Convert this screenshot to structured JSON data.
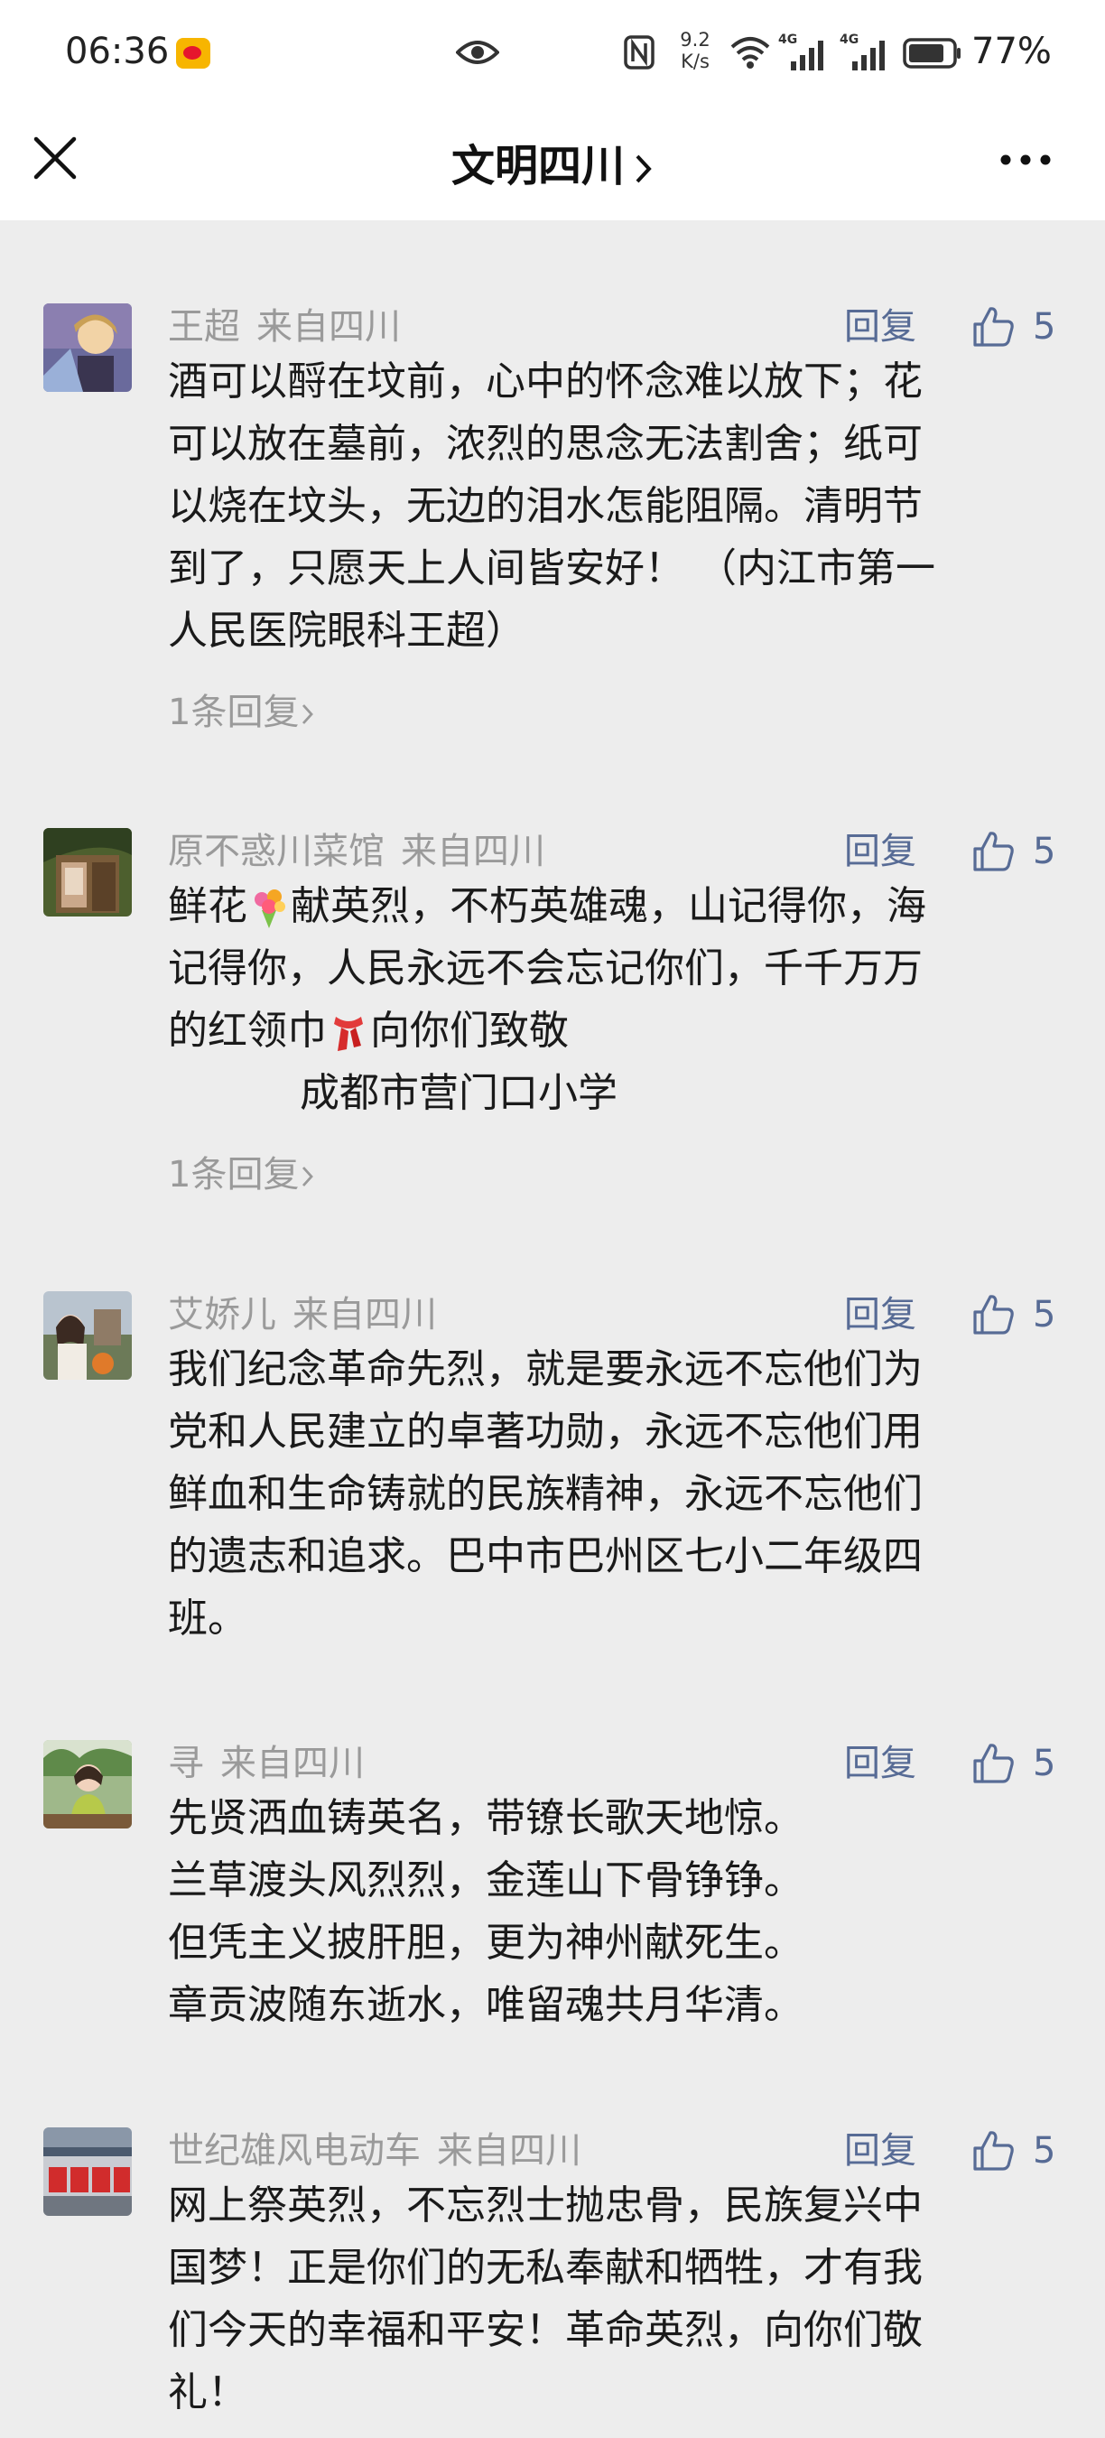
{
  "status_bar": {
    "time": "06:36",
    "net_speed_top": "9.2",
    "net_speed_bottom": "K/s",
    "signal1_label": "4G",
    "signal2_label": "4G",
    "battery": "77%"
  },
  "nav": {
    "title": "文明四川",
    "close_icon": "close-icon",
    "more_icon": "more-icon"
  },
  "labels": {
    "reply": "回复",
    "replies_link": "1条回复"
  },
  "colors": {
    "link": "#576b95",
    "meta": "#9a9a9a",
    "background": "#ededed"
  },
  "comments": [
    {
      "name": "王超",
      "location": "来自四川",
      "likes": "5",
      "lines": [
        "酒可以酹在坟前，心中的怀念难以放下；花",
        "可以放在墓前，浓烈的思念无法割舍；纸可",
        "以烧在坟头，无边的泪水怎能阻隔。清明节",
        "到了，只愿天上人间皆安好！ （内江市第一",
        "人民医院眼科王超）"
      ],
      "replies": "1条回复"
    },
    {
      "name": "原不惑川菜馆",
      "location": "来自四川",
      "likes": "5",
      "line1_a": "鲜花",
      "line1_b": "献英烈，不朽英雄魂，山记得你，海",
      "line2": "记得你，人民永远不会忘记你们，千千万万",
      "line3_a": "的红领巾",
      "line3_b": "向你们致敬",
      "line4": "成都市营门口小学",
      "replies": "1条回复"
    },
    {
      "name": "艾娇儿",
      "location": "来自四川",
      "likes": "5",
      "lines": [
        "我们纪念革命先烈，就是要永远不忘他们为",
        "党和人民建立的卓著功勋，永远不忘他们用",
        "鲜血和生命铸就的民族精神，永远不忘他们",
        "的遗志和追求。巴中市巴州区七小二年级四",
        "班。"
      ]
    },
    {
      "name": "寻",
      "location": "来自四川",
      "likes": "5",
      "lines": [
        "先贤洒血铸英名，带镣长歌天地惊。",
        "兰草渡头风烈烈，金莲山下骨铮铮。",
        "但凭主义披肝胆，更为神州献死生。",
        "章贡波随东逝水，唯留魂共月华清。"
      ]
    },
    {
      "name": "世纪雄风电动车",
      "location": "来自四川",
      "likes": "5",
      "lines": [
        "网上祭英烈，不忘烈士抛忠骨，民族复兴中",
        "国梦！正是你们的无私奉献和牺牲，才有我",
        "们今天的幸福和平安！革命英烈，向你们敬",
        "礼！"
      ]
    }
  ]
}
